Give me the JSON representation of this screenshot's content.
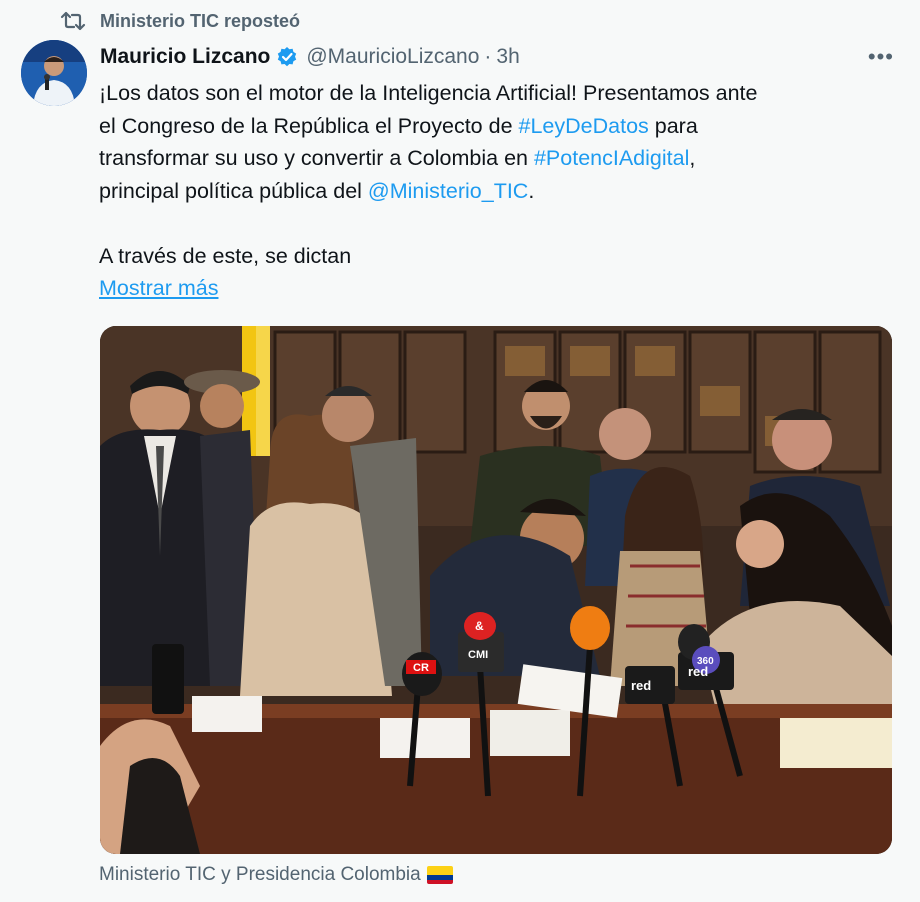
{
  "repost": {
    "text": "Ministerio TIC reposteó",
    "icon": "repost-icon"
  },
  "author": {
    "name": "Mauricio Lizcano",
    "handle": "@MauricioLizcano",
    "separator": "·",
    "time": "3h",
    "verified_icon": "verified-badge-icon",
    "more_label": "•••"
  },
  "tweet": {
    "line1": "¡Los datos son el motor de la Inteligencia Artificial! Presentamos ante",
    "line2_pre": "el Congreso de la República el Proyecto de ",
    "hashtag1": "#LeyDeDatos",
    "line2_post": " para",
    "line3_pre": "transformar su uso y convertir a Colombia en ",
    "hashtag2": "#PotencIAdigital",
    "line3_post": ",",
    "line4_pre": "principal política pública del ",
    "mention": "@Ministerio_TIC",
    "line4_post": ".",
    "line5": "A través de este, se dictan",
    "show_more": "Mostrar más"
  },
  "media": {
    "microphone_labels": [
      "CR",
      "&",
      "CMI",
      "red",
      "360",
      "red"
    ]
  },
  "caption": {
    "text": "Ministerio TIC y Presidencia Colombia",
    "flag_icon": "colombia-flag-icon"
  },
  "colors": {
    "link": "#1d9bf0",
    "secondary_text": "#536471",
    "background": "#f7f9f9",
    "verified": "#1d9bf0"
  }
}
